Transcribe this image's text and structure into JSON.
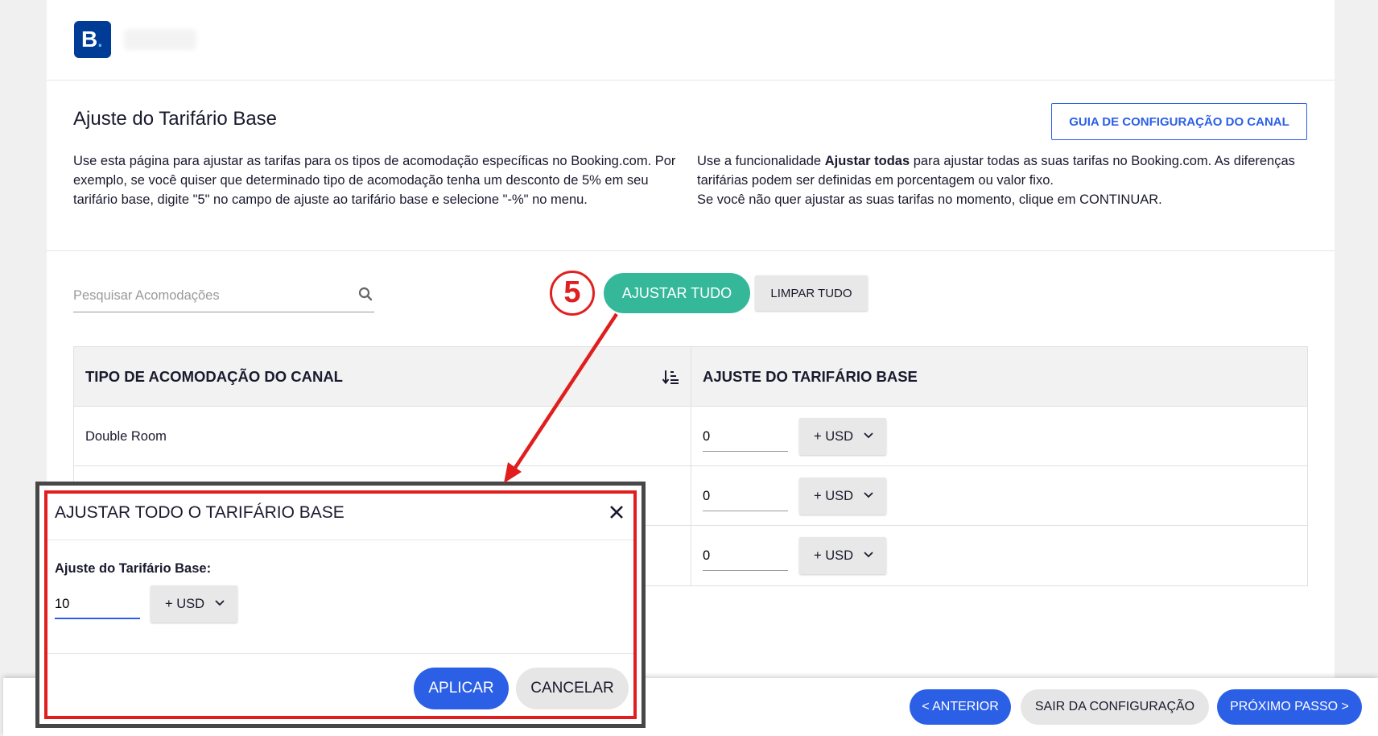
{
  "header": {
    "logo_letter": "B",
    "logo_dot": "."
  },
  "intro": {
    "title": "Ajuste do Tarifário Base",
    "guide_button": "GUIA DE CONFIGURAÇÃO DO CANAL",
    "left_text": "Use esta página para ajustar as tarifas para os tipos de acomodação específicas no Booking.com. Por exemplo, se você quiser que determinado tipo de acomodação tenha um desconto de 5% em seu tarifário base, digite \"5\" no campo de ajuste ao tarifário base e selecione \"-%\" no menu.",
    "right_text_prefix": "Use a funcionalidade ",
    "right_text_bold": "Ajustar todas",
    "right_text_suffix": " para ajustar todas as suas tarifas no Booking.com. As diferenças tarifárias podem ser definidas em porcentagem ou valor fixo.",
    "right_text_line2": "Se você não quer ajustar as suas tarifas no momento, clique em CONTINUAR."
  },
  "toolbar": {
    "search_placeholder": "Pesquisar Acomodações",
    "adjust_all_label": "AJUSTAR TUDO",
    "clear_all_label": "LIMPAR TUDO",
    "step_number": "5"
  },
  "table": {
    "col1_header": "TIPO DE ACOMODAÇÃO DO CANAL",
    "col2_header": "AJUSTE DO TARIFÁRIO BASE",
    "rows": [
      {
        "name": "Double Room",
        "value": "0",
        "currency": "+ USD"
      },
      {
        "name": "",
        "value": "0",
        "currency": "+ USD"
      },
      {
        "name": "",
        "value": "0",
        "currency": "+ USD"
      }
    ]
  },
  "modal": {
    "title": "AJUSTAR TODO O TARIFÁRIO BASE",
    "label": "Ajuste do Tarifário Base:",
    "value": "10",
    "currency": "+ USD",
    "apply_label": "APLICAR",
    "cancel_label": "CANCELAR"
  },
  "footer": {
    "prev_label": "< ANTERIOR",
    "exit_label": "SAIR DA CONFIGURAÇÃO",
    "next_label": "PRÓXIMO PASSO >"
  },
  "colors": {
    "brand_blue": "#003b95",
    "primary": "#2b5fe6",
    "teal": "#35b89a",
    "annotation_red": "#e01e1e"
  }
}
